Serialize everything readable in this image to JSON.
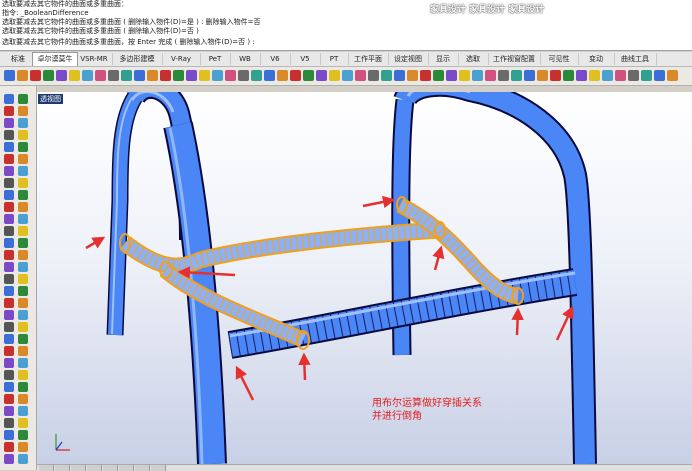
{
  "command_history": [
    "选取要减去其它物件的曲面或多重曲面：",
    "指令: _BooleanDifference",
    "选取要减去其它物件的曲面或多重曲面 ( 删除输入物件(D)=是 ) : 删除输入物件=否",
    "选取要减去其它物件的曲面或多重曲面 ( 删除输入物件(D)=否 )",
    "选取要减去其它物件的曲面或多重曲面，按 Enter 完成 ( 删除输入物件(D)=否 ) :"
  ],
  "watermark": "家具设计 家具设计 家具设计",
  "tabs": [
    {
      "label": "标准",
      "active": false
    },
    {
      "label": "卓尔谟莫牛",
      "active": true
    },
    {
      "label": "VSR-MR",
      "active": false
    },
    {
      "label": "多边形建模",
      "active": false
    },
    {
      "label": "V-Ray",
      "active": false
    },
    {
      "label": "PeT",
      "active": false
    },
    {
      "label": "WB",
      "active": false
    },
    {
      "label": "V6",
      "active": false
    },
    {
      "label": "V5",
      "active": false
    },
    {
      "label": "PT",
      "active": false
    },
    {
      "label": "工作平面",
      "active": false
    },
    {
      "label": "设定视图",
      "active": false
    },
    {
      "label": "显示",
      "active": false
    },
    {
      "label": "选取",
      "active": false
    },
    {
      "label": "工作视窗配置",
      "active": false
    },
    {
      "label": "可见性",
      "active": false
    },
    {
      "label": "变动",
      "active": false
    },
    {
      "label": "曲线工具",
      "active": false
    }
  ],
  "viewport_label": "透视图",
  "annotation": [
    "用布尔运算做好穿插关系",
    "并进行倒角"
  ],
  "colors": {
    "object_blue": "#4a86f5",
    "object_edge": "#0a0a40",
    "selection": "#f0a020",
    "arrow": "#e63030",
    "viewport_top": "#ffffff",
    "viewport_bottom": "#c8d0e6"
  }
}
